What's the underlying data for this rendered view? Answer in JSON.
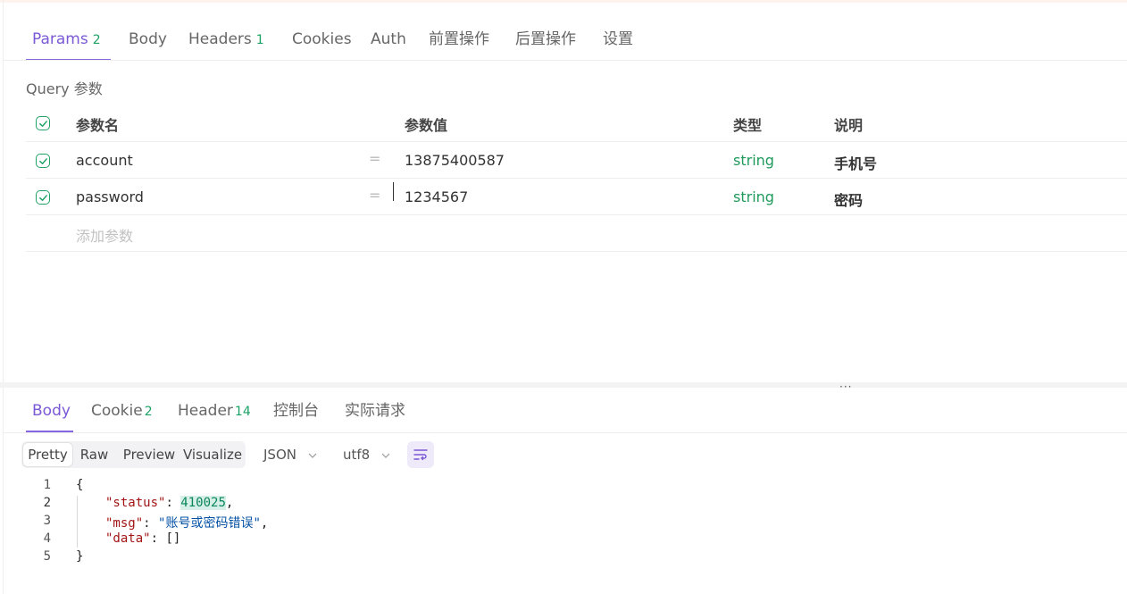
{
  "request_tabs": [
    {
      "label": "Params",
      "count": "2"
    },
    {
      "label": "Body",
      "count": ""
    },
    {
      "label": "Headers",
      "count": "1"
    },
    {
      "label": "Cookies",
      "count": ""
    },
    {
      "label": "Auth",
      "count": ""
    },
    {
      "label": "前置操作",
      "count": ""
    },
    {
      "label": "后置操作",
      "count": ""
    },
    {
      "label": "设置",
      "count": ""
    }
  ],
  "query": {
    "section_label": "Query 参数",
    "columns": {
      "name": "参数名",
      "value": "参数值",
      "type": "类型",
      "desc": "说明"
    },
    "rows": [
      {
        "name": "account",
        "eq": "=",
        "value": "13875400587",
        "type": "string",
        "desc": "手机号"
      },
      {
        "name": "password",
        "eq": "=",
        "value": "1234567",
        "type": "string",
        "desc": "密码"
      }
    ],
    "add_placeholder": "添加参数"
  },
  "resize_handle": "···",
  "response_tabs": [
    {
      "label": "Body",
      "count": ""
    },
    {
      "label": "Cookie",
      "count": "2"
    },
    {
      "label": "Header",
      "count": "14"
    },
    {
      "label": "控制台",
      "count": ""
    },
    {
      "label": "实际请求",
      "count": ""
    }
  ],
  "view_modes": [
    "Pretty",
    "Raw",
    "Preview",
    "Visualize"
  ],
  "format_select": "JSON",
  "encoding_select": "utf8",
  "response_body": {
    "line_numbers": [
      "1",
      "2",
      "3",
      "4",
      "5"
    ],
    "open_brace": "{",
    "status_key": "\"status\"",
    "status_value": "410025",
    "msg_key": "\"msg\"",
    "msg_value": "\"账号或密码错误\"",
    "data_key": "\"data\"",
    "data_value": "[]",
    "close_brace": "}"
  },
  "colors": {
    "accent": "#7a58d6",
    "green": "#1aa265"
  }
}
